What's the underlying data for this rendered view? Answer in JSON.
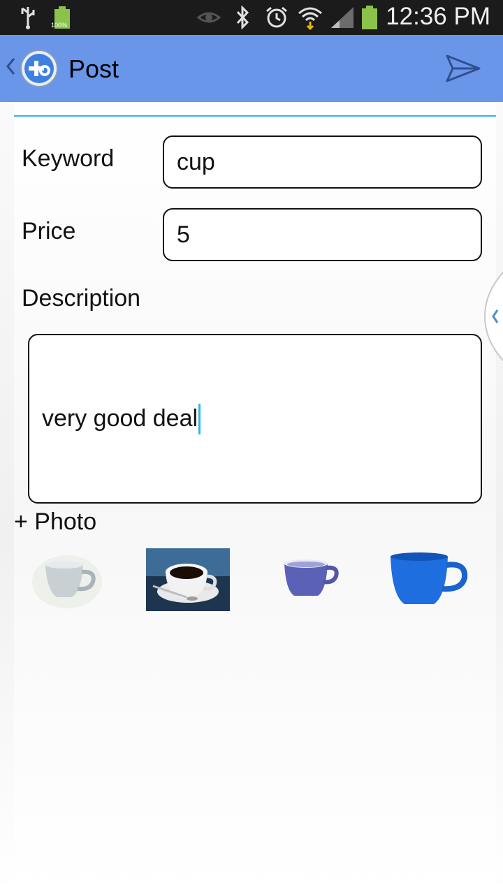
{
  "status_bar": {
    "time": "12:36 PM",
    "battery_small_label": "100%",
    "icons": [
      "usb-icon",
      "battery-full-icon",
      "eye-icon",
      "bluetooth-icon",
      "alarm-icon",
      "wifi-icon",
      "signal-icon",
      "battery-icon"
    ]
  },
  "action_bar": {
    "title": "Post",
    "icons": [
      "up-caret-icon",
      "app-logo-icon",
      "send-icon"
    ]
  },
  "form": {
    "keyword_label": "Keyword",
    "keyword_value": "cup",
    "price_label": "Price",
    "price_value": "5",
    "description_label": "Description",
    "description_value": "very good deal",
    "add_photo_label": "+ Photo"
  },
  "photos": [
    "white-cup-photo",
    "coffee-cup-photo",
    "purple-cup-photo",
    "blue-cup-photo"
  ],
  "colors": {
    "action_bar": "#6a96ea",
    "accent": "#33b5e5",
    "status_bar": "#1b1b1b"
  }
}
